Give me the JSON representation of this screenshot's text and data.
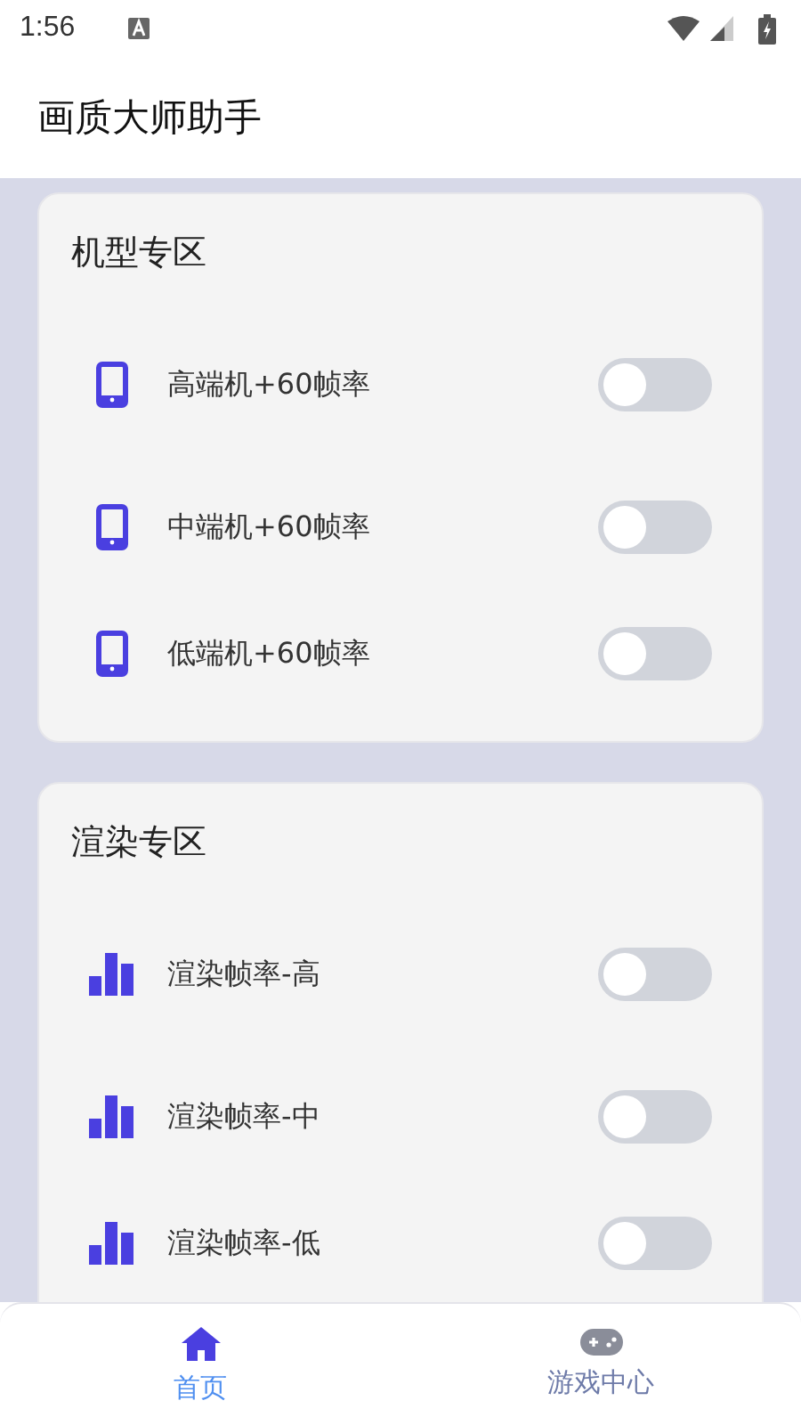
{
  "status_bar": {
    "time": "1:56"
  },
  "app_bar": {
    "title": "画质大师助手"
  },
  "sections": [
    {
      "title": "机型专区",
      "kind": "phone",
      "items": [
        {
          "label": "高端机+60帧率",
          "on": false
        },
        {
          "label": "中端机+60帧率",
          "on": false
        },
        {
          "label": "低端机+60帧率",
          "on": false
        }
      ]
    },
    {
      "title": "渲染专区",
      "kind": "bars",
      "items": [
        {
          "label": "渲染帧率-高",
          "on": false
        },
        {
          "label": "渲染帧率-中",
          "on": false
        },
        {
          "label": "渲染帧率-低",
          "on": false
        }
      ]
    }
  ],
  "bottom_nav": [
    {
      "label": "首页",
      "kind": "home",
      "selected": true
    },
    {
      "label": "游戏中心",
      "kind": "gamepad",
      "selected": false
    }
  ]
}
